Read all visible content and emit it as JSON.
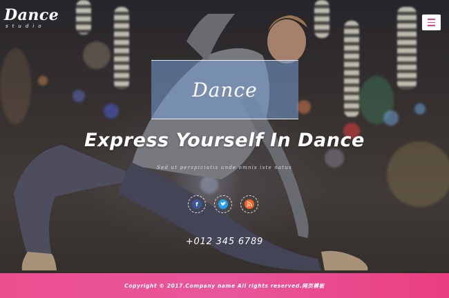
{
  "brand": {
    "name": "Dance",
    "tagline": "studio"
  },
  "hero": {
    "title_word": "Dance",
    "headline": "Express Yourself In Dance",
    "subtitle": "Sed ut perspiciatis unde omnis iste natus",
    "phone": "+012 345 6789"
  },
  "social": [
    {
      "icon": "facebook-icon",
      "glyph": "f",
      "color": "#3b5998"
    },
    {
      "icon": "twitter-icon",
      "glyph": "t",
      "color": "#1da1f2"
    },
    {
      "icon": "rss-icon",
      "glyph": "◎",
      "color": "#f26522"
    }
  ],
  "footer": {
    "copyright": "Copyright © 2017.Company name All rights reserved.网页模板"
  },
  "colors": {
    "accent": "#e8407f",
    "footer_bg": "#ec4f90",
    "title_box": "#78a0d7"
  }
}
